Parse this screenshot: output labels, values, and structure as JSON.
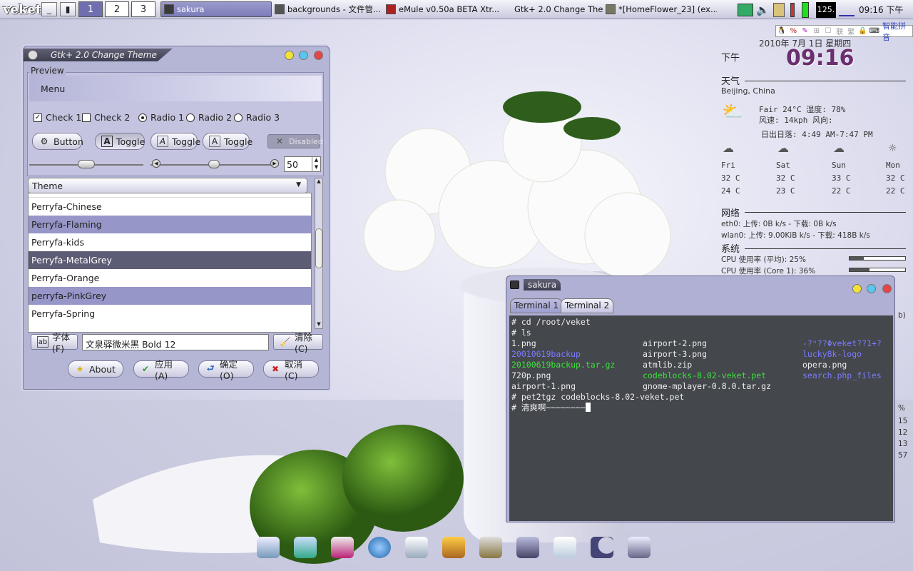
{
  "taskbar": {
    "logo": "veket",
    "desktops": [
      "1",
      "2",
      "3"
    ],
    "tasks": [
      {
        "label": "sakura",
        "active": true
      },
      {
        "label": "backgrounds - 文件管...",
        "active": false
      },
      {
        "label": "eMule v0.50a BETA Xtr...",
        "active": false
      },
      {
        "label": "Gtk+ 2.0 Change The...",
        "active": false
      },
      {
        "label": "*[HomeFlower_23] (ex...",
        "active": false
      }
    ],
    "tray_cpu": "125.",
    "clock": "09:16 下午",
    "ime": "智能拼音"
  },
  "conky": {
    "date": "2010年  7月  1日  星期四",
    "ampm": "下午",
    "time": "09:16",
    "weather_header": "天气",
    "location": "Beijing, China",
    "current": "Fair  24°C  湿度: 78%",
    "wind": "风速: 14kph  风向:",
    "sun": "日出日落: 4:49 AM-7:47 PM",
    "forecast": [
      {
        "day": "Fri",
        "high": "32 C",
        "low": "24 C"
      },
      {
        "day": "Sat",
        "high": "32 C",
        "low": "23 C"
      },
      {
        "day": "Sun",
        "high": "33 C",
        "low": "22 C"
      },
      {
        "day": "Mon",
        "high": "32 C",
        "low": "22 C"
      }
    ],
    "net_header": "网络",
    "eth0": "eth0: 上传: 0B   k/s - 下载: 0B   k/s",
    "wlan0": "wlan0: 上传: 9.00KiB k/s - 下载: 418B   k/s",
    "sys_header": "系统",
    "cpu_avg": "CPU 使用率 (平均): 25%",
    "cpu_core1": "CPU 使用率 (Core 1): 36%",
    "cpu_avg_pct": 25,
    "cpu_core1_pct": 36,
    "partial": [
      "b)",
      "%",
      "15",
      "12",
      "13",
      "57"
    ]
  },
  "gtk": {
    "title": "Gtk+ 2.0 Change Theme",
    "preview_label": "Preview",
    "menu": "Menu",
    "check1": "Check 1",
    "check2": "Check 2",
    "radio1": "Radio 1",
    "radio2": "Radio 2",
    "radio3": "Radio 3",
    "button": "Button",
    "toggle": "Toggle",
    "disabled": "Disabled",
    "spin_value": "50",
    "theme_combo": "Theme",
    "themes": [
      "Perryfa-Chinese",
      "Perryfa-Flaming",
      "Perryfa-kids",
      "Perryfa-MetalGrey",
      "Perryfa-Orange",
      "perryfa-PinkGrey",
      "Perryfa-Spring"
    ],
    "font_button": "字体(F)",
    "font_value": "文泉驿微米黑 Bold 12",
    "clear_button": "清除(C)",
    "about": "About",
    "apply": "应用(A)",
    "ok": "确定(O)",
    "cancel": "取消(C)"
  },
  "terminal": {
    "title": "sakura",
    "tabs": [
      "Terminal 1",
      "Terminal 2"
    ],
    "line1": "# cd /root/veket",
    "line2": "# ls",
    "col1": [
      "1.png",
      "20010619backup",
      "20100619backup.tar.gz",
      "720p.png",
      "airport-1.png"
    ],
    "col2": [
      "airport-2.png",
      "airport-3.png",
      "atmlib.zip",
      "codeblocks-8.02-veket.pet",
      "gnome-mplayer-0.8.0.tar.gz"
    ],
    "col3": [
      "-?ⁿ??Φveket??1+?",
      "lucky8k-logo",
      "opera.png",
      "search.php_files",
      ""
    ],
    "line8": "# pet2tgz codeblocks-8.02-veket.pet",
    "line9": "# 清爽啊~~~~~~~~"
  },
  "colors": {
    "accent": "#9696c8",
    "dir_blue": "#7b7bff",
    "exec_green": "#3be23b",
    "clock_purple": "#6b2e6e"
  }
}
